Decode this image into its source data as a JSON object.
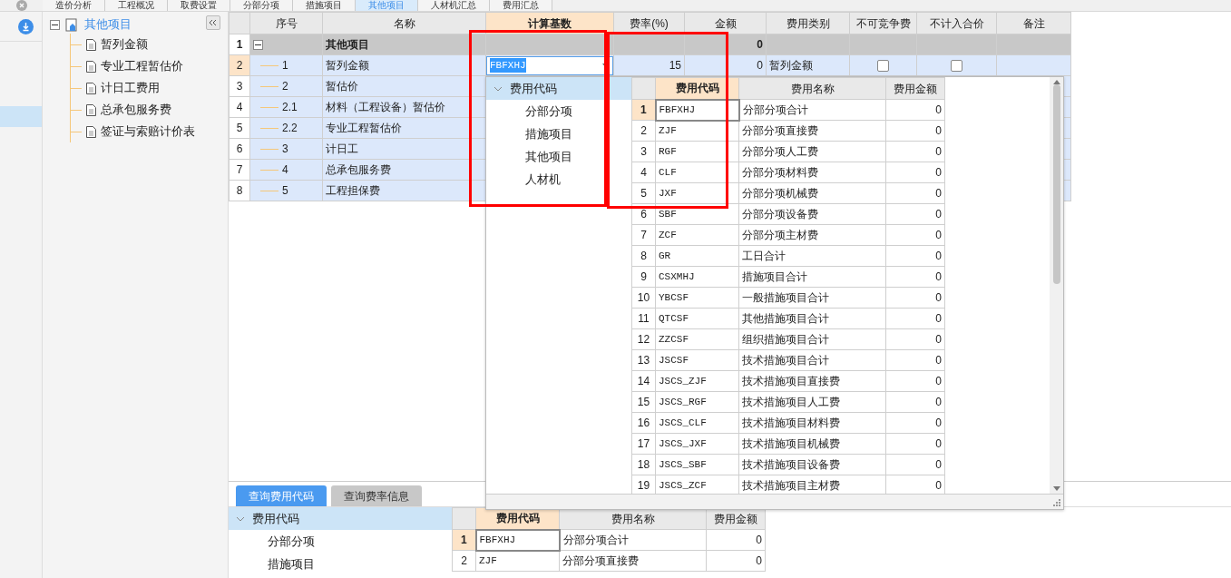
{
  "top_tabs": [
    {
      "label": "造价分析",
      "selected": false
    },
    {
      "label": "工程概况",
      "selected": false
    },
    {
      "label": "取费设置",
      "selected": false
    },
    {
      "label": "分部分项",
      "selected": false
    },
    {
      "label": "措施项目",
      "selected": false
    },
    {
      "label": "其他项目",
      "selected": true
    },
    {
      "label": "人材机汇总",
      "selected": false
    },
    {
      "label": "费用汇总",
      "selected": false
    }
  ],
  "side_rail": {
    "items": [
      {
        "selected": false
      },
      {
        "selected": true
      }
    ]
  },
  "nav_tree": {
    "label": "其他项目",
    "expanded": true,
    "children": [
      {
        "label": "暂列金额"
      },
      {
        "label": "专业工程暂估价"
      },
      {
        "label": "计日工费用"
      },
      {
        "label": "总承包服务费"
      },
      {
        "label": "签证与索赔计价表"
      }
    ]
  },
  "grid": {
    "columns": [
      "序号",
      "名称",
      "计算基数",
      "费率(%)",
      "金额",
      "费用类别",
      "不可竞争费",
      "不计入合价",
      "备注"
    ],
    "rows": [
      {
        "kind": "group",
        "num": "1",
        "seq": "",
        "name": "其他项目",
        "amount": "0",
        "expanded": true,
        "selected": false
      },
      {
        "kind": "editing",
        "num": "2",
        "seq": "1",
        "name": "暂列金额",
        "base": "FBFXHJ",
        "rate": "15",
        "amount": "0",
        "category": "暂列金额",
        "no_compete": false,
        "not_in_total": false,
        "selected": true
      },
      {
        "kind": "item",
        "num": "3",
        "seq": "2",
        "name": "暂估价",
        "selected": false
      },
      {
        "kind": "item",
        "num": "4",
        "seq": "2.1",
        "name": "材料（工程设备）暂估价",
        "selected": false
      },
      {
        "kind": "item",
        "num": "5",
        "seq": "2.2",
        "name": "专业工程暂估价",
        "selected": false
      },
      {
        "kind": "item",
        "num": "6",
        "seq": "3",
        "name": "计日工",
        "selected": false
      },
      {
        "kind": "item",
        "num": "7",
        "seq": "4",
        "name": "总承包服务费",
        "selected": false
      },
      {
        "kind": "item",
        "num": "8",
        "seq": "5",
        "name": "工程担保费",
        "selected": false
      }
    ]
  },
  "popup": {
    "tree": {
      "label": "费用代码",
      "expanded": true,
      "selected": true,
      "children": [
        {
          "label": "分部分项"
        },
        {
          "label": "措施项目"
        },
        {
          "label": "其他项目"
        },
        {
          "label": "人材机"
        }
      ]
    },
    "table": {
      "columns": [
        "费用代码",
        "费用名称",
        "费用金额"
      ],
      "rows": [
        {
          "num": "1",
          "code": "FBFXHJ",
          "name": "分部分项合计",
          "amount": "0",
          "selected": true
        },
        {
          "num": "2",
          "code": "ZJF",
          "name": "分部分项直接费",
          "amount": "0",
          "selected": false
        },
        {
          "num": "3",
          "code": "RGF",
          "name": "分部分项人工费",
          "amount": "0",
          "selected": false
        },
        {
          "num": "4",
          "code": "CLF",
          "name": "分部分项材料费",
          "amount": "0",
          "selected": false
        },
        {
          "num": "5",
          "code": "JXF",
          "name": "分部分项机械费",
          "amount": "0",
          "selected": false
        },
        {
          "num": "6",
          "code": "SBF",
          "name": "分部分项设备费",
          "amount": "0",
          "selected": false
        },
        {
          "num": "7",
          "code": "ZCF",
          "name": "分部分项主材费",
          "amount": "0",
          "selected": false
        },
        {
          "num": "8",
          "code": "GR",
          "name": "工日合计",
          "amount": "0",
          "selected": false
        },
        {
          "num": "9",
          "code": "CSXMHJ",
          "name": "措施项目合计",
          "amount": "0",
          "selected": false
        },
        {
          "num": "10",
          "code": "YBCSF",
          "name": "一般措施项目合计",
          "amount": "0",
          "selected": false
        },
        {
          "num": "11",
          "code": "QTCSF",
          "name": "其他措施项目合计",
          "amount": "0",
          "selected": false
        },
        {
          "num": "12",
          "code": "ZZCSF",
          "name": "组织措施项目合计",
          "amount": "0",
          "selected": false
        },
        {
          "num": "13",
          "code": "JSCSF",
          "name": "技术措施项目合计",
          "amount": "0",
          "selected": false
        },
        {
          "num": "14",
          "code": "JSCS_ZJF",
          "name": "技术措施项目直接费",
          "amount": "0",
          "selected": false
        },
        {
          "num": "15",
          "code": "JSCS_RGF",
          "name": "技术措施项目人工费",
          "amount": "0",
          "selected": false
        },
        {
          "num": "16",
          "code": "JSCS_CLF",
          "name": "技术措施项目材料费",
          "amount": "0",
          "selected": false
        },
        {
          "num": "17",
          "code": "JSCS_JXF",
          "name": "技术措施项目机械费",
          "amount": "0",
          "selected": false
        },
        {
          "num": "18",
          "code": "JSCS_SBF",
          "name": "技术措施项目设备费",
          "amount": "0",
          "selected": false
        },
        {
          "num": "19",
          "code": "JSCS_ZCF",
          "name": "技术措施项目主材费",
          "amount": "0",
          "selected": false
        }
      ]
    }
  },
  "bottom": {
    "tabs": [
      {
        "label": "查询费用代码",
        "selected": true
      },
      {
        "label": "查询费率信息",
        "selected": false
      }
    ],
    "tree": {
      "label": "费用代码",
      "expanded": true,
      "selected": true,
      "children": [
        {
          "label": "分部分项"
        },
        {
          "label": "措施项目"
        }
      ]
    },
    "table": {
      "columns": [
        "费用代码",
        "费用名称",
        "费用金额"
      ],
      "rows": [
        {
          "num": "1",
          "code": "FBFXHJ",
          "name": "分部分项合计",
          "amount": "0",
          "selected": true
        },
        {
          "num": "2",
          "code": "ZJF",
          "name": "分部分项直接费",
          "amount": "0",
          "selected": false
        }
      ]
    }
  },
  "annotation_frames": [
    {
      "color": "#ff0000"
    },
    {
      "color": "#ff0000"
    }
  ]
}
